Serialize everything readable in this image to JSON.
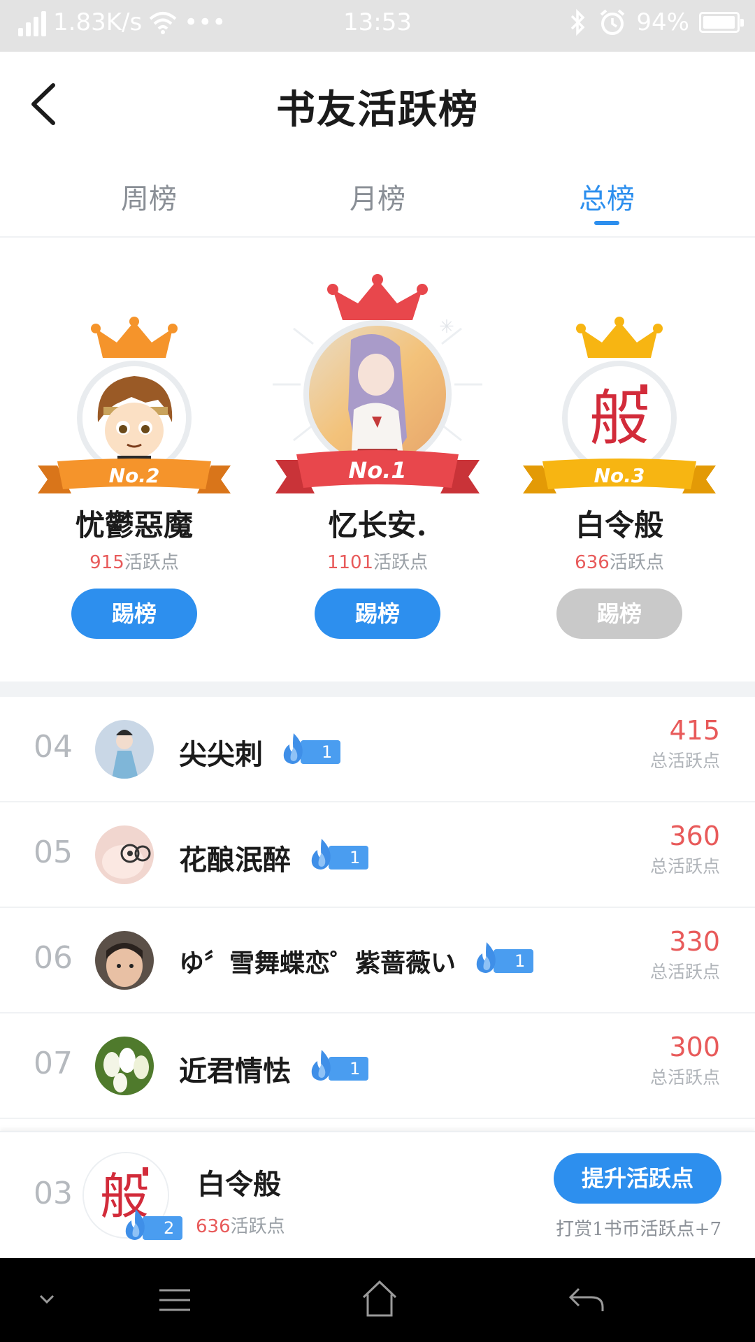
{
  "status_bar": {
    "net_speed": "1.83K/s",
    "dots": "•••",
    "time": "13:53",
    "battery": "94%",
    "battery_level": 0.94
  },
  "header": {
    "title": "书友活跃榜"
  },
  "tabs": [
    {
      "label": "周榜",
      "active": false
    },
    {
      "label": "月榜",
      "active": false
    },
    {
      "label": "总榜",
      "active": true
    }
  ],
  "podium": {
    "second": {
      "badge": "No.2",
      "name": "忧鬱惡魔",
      "points": "915",
      "unit": "活跃点",
      "button": "踢榜",
      "crown_color": "#f5942b"
    },
    "first": {
      "badge": "No.1",
      "name": "忆长安.",
      "points": "1101",
      "unit": "活跃点",
      "button": "踢榜",
      "crown_color": "#e8474c"
    },
    "third": {
      "badge": "No.3",
      "name": "白令般",
      "points": "636",
      "unit": "活跃点",
      "button": "踢榜",
      "crown_color": "#f7b512"
    }
  },
  "list": [
    {
      "rank": "04",
      "name": "尖尖刺",
      "badge": "1",
      "score": "415",
      "unit": "总活跃点"
    },
    {
      "rank": "05",
      "name": "花酿泯醉",
      "badge": "1",
      "score": "360",
      "unit": "总活跃点"
    },
    {
      "rank": "06",
      "name": "ゆ〞雪舞蝶恋゜紫蔷薇い",
      "badge": "1",
      "score": "330",
      "unit": "总活跃点"
    },
    {
      "rank": "07",
      "name": "近君情怯",
      "badge": "1",
      "score": "300",
      "unit": "总活跃点"
    }
  ],
  "my_rank": {
    "rank": "03",
    "name": "白令般",
    "points": "636",
    "unit": "活跃点",
    "badge": "2",
    "avatar_text": "般",
    "button": "提升活跃点",
    "hint": "打赏1书币活跃点+7"
  },
  "colors": {
    "accent": "#2d8fee",
    "score_red": "#e85a5a"
  }
}
